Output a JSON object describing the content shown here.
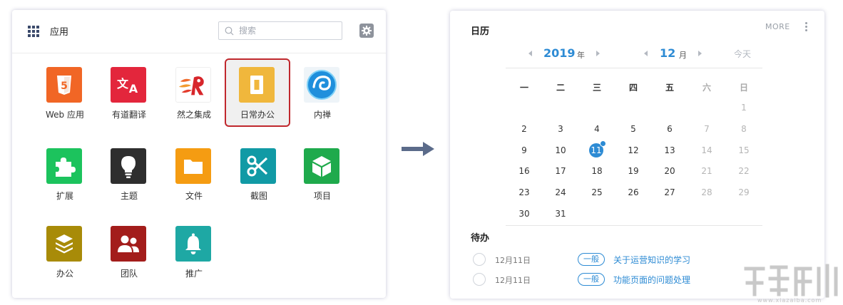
{
  "apps": {
    "title": "应用",
    "search": {
      "placeholder": "搜索",
      "value": ""
    },
    "settings_icon": "gear-icon",
    "items": [
      {
        "label": "Web 应用",
        "icon": "html5-icon",
        "color": "#f16625"
      },
      {
        "label": "有道翻译",
        "icon": "translate-icon",
        "color": "#e3263c"
      },
      {
        "label": "然之集成",
        "icon": "ranzhi-logo-icon",
        "color": "#ffffff"
      },
      {
        "label": "日常办公",
        "icon": "office-icon",
        "color": "#f0b73c",
        "selected": true
      },
      {
        "label": "内禅",
        "icon": "neichan-logo-icon",
        "color": "#2f9fe0"
      },
      {
        "label": "扩展",
        "icon": "puzzle-icon",
        "color": "#1cc35d"
      },
      {
        "label": "主题",
        "icon": "lightbulb-icon",
        "color": "#2e2e2e"
      },
      {
        "label": "文件",
        "icon": "folder-icon",
        "color": "#f59c12"
      },
      {
        "label": "截图",
        "icon": "scissors-icon",
        "color": "#119aa5"
      },
      {
        "label": "项目",
        "icon": "cube-icon",
        "color": "#1faa4c"
      },
      {
        "label": "办公",
        "icon": "layers-icon",
        "color": "#a88b08"
      },
      {
        "label": "团队",
        "icon": "team-icon",
        "color": "#a31d1b"
      },
      {
        "label": "推广",
        "icon": "bell-icon",
        "color": "#1ea8a4"
      }
    ]
  },
  "calendar": {
    "title": "日历",
    "more": "MORE",
    "year": "2019",
    "year_unit": "年",
    "month": "12",
    "month_unit": "月",
    "today_label": "今天",
    "weekdays": [
      "一",
      "二",
      "三",
      "四",
      "五",
      "六",
      "日"
    ],
    "weeks": [
      [
        "",
        "",
        "",
        "",
        "",
        "",
        "1"
      ],
      [
        "2",
        "3",
        "4",
        "5",
        "6",
        "7",
        "8"
      ],
      [
        "9",
        "10",
        "11",
        "12",
        "13",
        "14",
        "15"
      ],
      [
        "16",
        "17",
        "18",
        "19",
        "20",
        "21",
        "22"
      ],
      [
        "23",
        "24",
        "25",
        "26",
        "27",
        "28",
        "29"
      ],
      [
        "30",
        "31",
        "",
        "",
        "",
        "",
        ""
      ]
    ],
    "today": "11",
    "accent": "#2d8bd4"
  },
  "todo": {
    "title": "待办",
    "items": [
      {
        "date": "12月11日",
        "tag": "一般",
        "text": "关于运营知识的学习"
      },
      {
        "date": "12月11日",
        "tag": "一般",
        "text": "功能页面的问题处理"
      }
    ]
  },
  "watermark": {
    "url": "www.xiazaiba.com"
  }
}
